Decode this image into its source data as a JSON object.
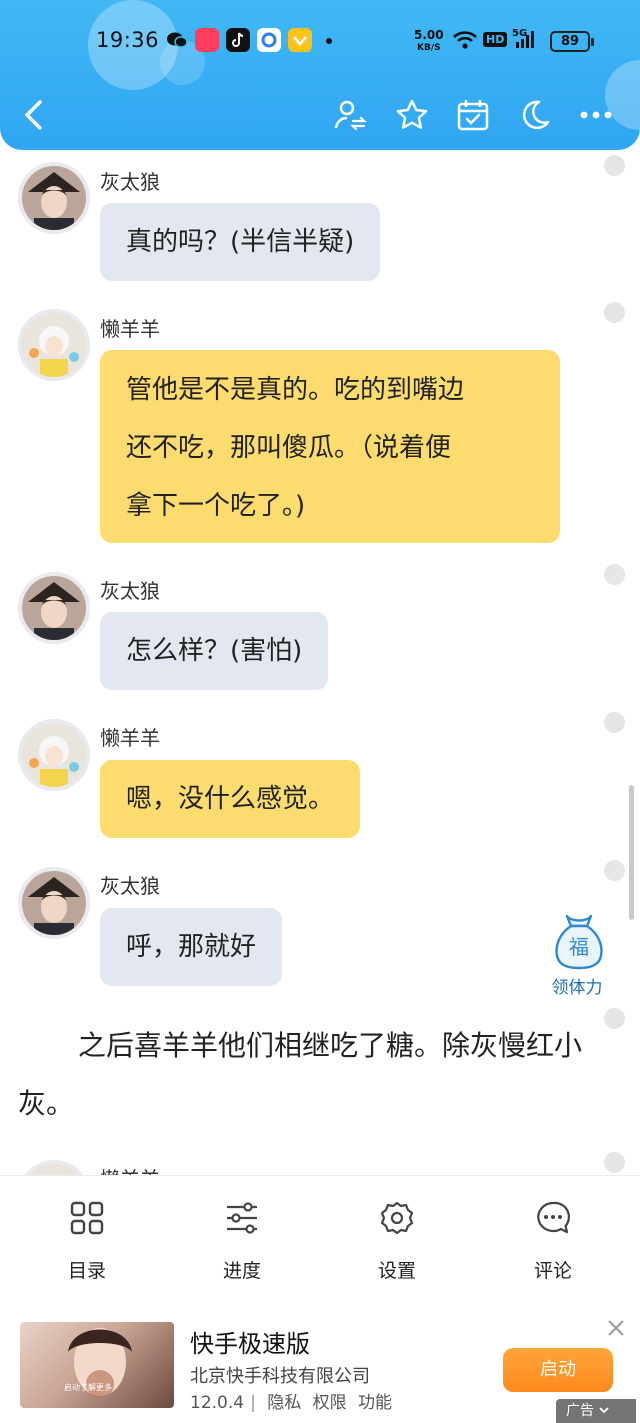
{
  "status_bar": {
    "time": "19:36",
    "net_speed_value": "5.00",
    "net_speed_unit": "KB/S",
    "hd_label": "HD",
    "signal_label": "5G",
    "battery": "89"
  },
  "colors": {
    "header": "#35aef3",
    "gray_bubble": "#e3e7ef",
    "yellow_bubble": "#fddc6f",
    "ad_button": "#ff8a1e"
  },
  "toolbar": {
    "icons": [
      "back-icon",
      "switch-user-icon",
      "star-icon",
      "calendar-check-icon",
      "moon-icon",
      "more-icon"
    ]
  },
  "messages": [
    {
      "speaker": "灰太狼",
      "text": "真的吗？(半信半疑)",
      "style": "gray"
    },
    {
      "speaker": "懒羊羊",
      "text": "管他是不是真的。吃的到嘴边\n还不吃，那叫傻瓜。（说着便\n拿下一个吃了。)",
      "style": "yellow"
    },
    {
      "speaker": "灰太狼",
      "text": "怎么样？(害怕)",
      "style": "gray"
    },
    {
      "speaker": "懒羊羊",
      "text": "嗯，没什么感觉。",
      "style": "yellow"
    },
    {
      "speaker": "灰太狼",
      "text": "呼，那就好",
      "style": "gray"
    }
  ],
  "narration": "之后喜羊羊他们相继吃了糖。除灰慢红小灰。",
  "partial_speaker": "懒羊羊",
  "fab": {
    "glyph": "福",
    "label": "领体力"
  },
  "bottom_nav": [
    {
      "label": "目录",
      "icon": "grid-icon"
    },
    {
      "label": "进度",
      "icon": "sliders-icon"
    },
    {
      "label": "设置",
      "icon": "gear-icon"
    },
    {
      "label": "评论",
      "icon": "comment-icon"
    }
  ],
  "ad": {
    "thumb_caption": "启动了解更多",
    "title": "快手极速版",
    "company": "北京快手科技有限公司",
    "version": "12.0.4",
    "separator": "|",
    "links": [
      "隐私",
      "权限",
      "功能"
    ],
    "button": "启动",
    "tag": "广告"
  }
}
